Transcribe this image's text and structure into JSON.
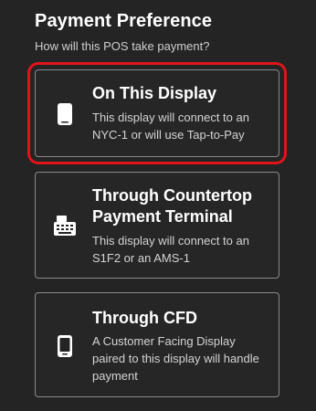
{
  "page": {
    "title": "Payment Preference",
    "subtitle": "How will this POS take payment?"
  },
  "options": [
    {
      "heading": "On This Display",
      "description": "This display will connect to an NYC-1 or will use Tap-to-Pay",
      "icon": "tablet-icon",
      "selected": true
    },
    {
      "heading": "Through Countertop Payment Terminal",
      "description": "This display will connect to an S1F2 or an AMS-1",
      "icon": "payment-terminal-icon",
      "selected": false
    },
    {
      "heading": "Through CFD",
      "description": "A Customer Facing Display paired to this display will handle payment",
      "icon": "phone-icon",
      "selected": false
    }
  ],
  "colors": {
    "background": "#242424",
    "card_border": "#8a8a8a",
    "highlight": "#e0141a",
    "text_primary": "#ffffff",
    "text_secondary": "#d4d4d4"
  }
}
